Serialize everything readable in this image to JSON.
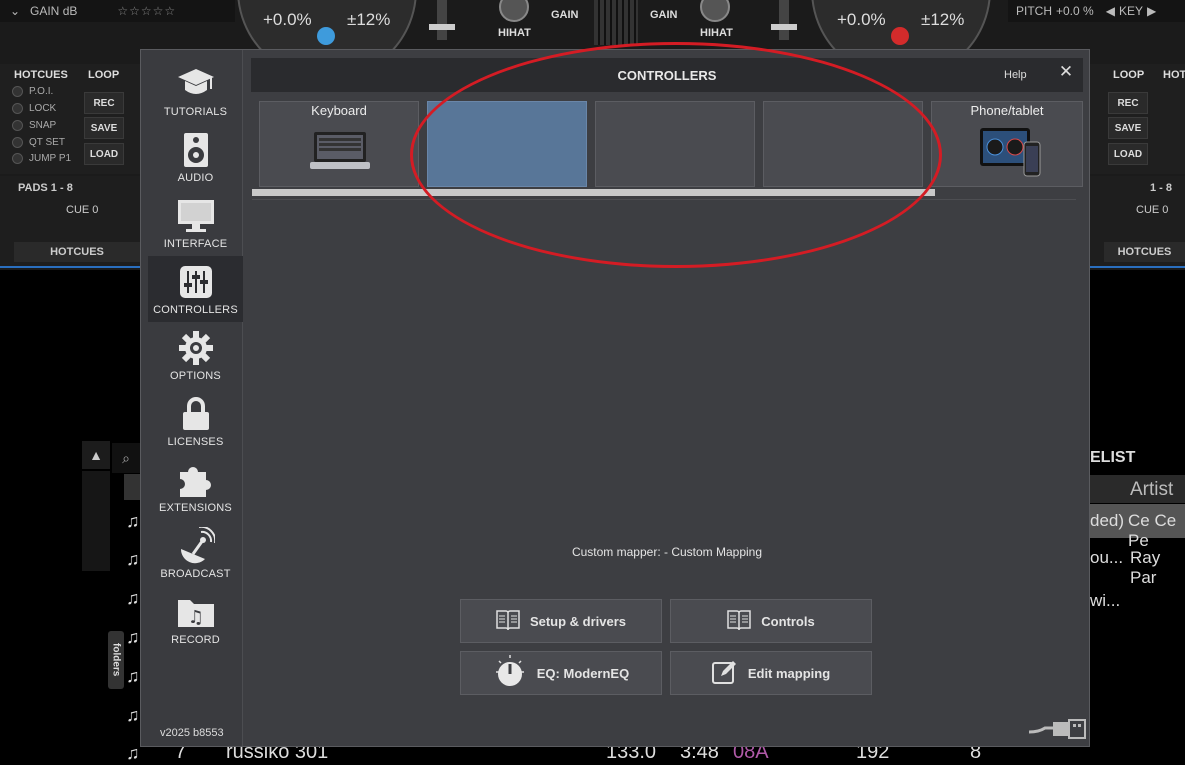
{
  "background": {
    "gain_label": "GAIN",
    "gain_unit": "dB",
    "rating_stars": "☆☆☆☆☆",
    "left_deck": {
      "pitch_pct": "+0.0%",
      "range": "±12%",
      "dot_color": "#3e9bdc"
    },
    "right_deck": {
      "pitch_pct": "+0.0%",
      "range": "±12%",
      "dot_color": "#d32b2b"
    },
    "mixer": {
      "gain_left": "GAIN",
      "gain_right": "GAIN",
      "hihat_left": "HIHAT",
      "hihat_right": "HIHAT"
    },
    "pitch_label": "PITCH",
    "pitch_value": "+0.0 %",
    "key_label": "KEY",
    "left_panel": {
      "hotcues": "HOTCUES",
      "loop": "LOOP",
      "items": [
        "P.O.I.",
        "LOCK",
        "SNAP",
        "QT SET",
        "JUMP P1"
      ],
      "buttons": [
        "REC",
        "SAVE",
        "LOAD"
      ],
      "pads_title": "PADS 1 - 8",
      "cue": "CUE 0",
      "hotcues_bar": "HOTCUES"
    },
    "right_panel": {
      "loop": "LOOP",
      "hotcues_short": "HOT",
      "buttons": [
        "REC",
        "SAVE",
        "LOAD"
      ],
      "pads_title": "1 - 8",
      "cue": "CUE 0",
      "hotcues_bar": "HOTCUES"
    },
    "browser": {
      "folders_tab": "folders",
      "playlist_header": "ELIST",
      "artist_header": "Artist",
      "rows": [
        {
          "left": "ded)",
          "right": "Ce Ce Pe"
        },
        {
          "left": "ou...",
          "right": "Ray Par"
        },
        {
          "left": "wi...",
          "right": ""
        }
      ],
      "track": {
        "num": "7",
        "title": "russiko 301",
        "bpm": "133.0",
        "length": "3:48",
        "key": "08A",
        "bitrate": "192",
        "plays": "8"
      }
    }
  },
  "dialog": {
    "title": "CONTROLLERS",
    "help_label": "Help",
    "version": "v2025 b8553",
    "nav": [
      {
        "id": "tutorials",
        "label": "TUTORIALS",
        "icon": "mortarboard-icon",
        "active": false
      },
      {
        "id": "audio",
        "label": "AUDIO",
        "icon": "speaker-icon",
        "active": false
      },
      {
        "id": "interface",
        "label": "INTERFACE",
        "icon": "monitor-icon",
        "active": false
      },
      {
        "id": "controllers",
        "label": "CONTROLLERS",
        "icon": "sliders-icon",
        "active": true
      },
      {
        "id": "options",
        "label": "OPTIONS",
        "icon": "gear-icon",
        "active": false
      },
      {
        "id": "licenses",
        "label": "LICENSES",
        "icon": "lock-icon",
        "active": false
      },
      {
        "id": "extensions",
        "label": "EXTENSIONS",
        "icon": "puzzle-icon",
        "active": false
      },
      {
        "id": "broadcast",
        "label": "BROADCAST",
        "icon": "satellite-dish-icon",
        "active": false
      },
      {
        "id": "record",
        "label": "RECORD",
        "icon": "music-folder-icon",
        "active": false
      }
    ],
    "controllers": [
      {
        "label": "Keyboard",
        "icon": "laptop-icon",
        "selected": false
      },
      {
        "label": "",
        "icon": "",
        "selected": true
      },
      {
        "label": "",
        "icon": "",
        "selected": false
      },
      {
        "label": "",
        "icon": "",
        "selected": false
      },
      {
        "label": "Phone/tablet",
        "icon": "tablet-phone-icon",
        "selected": false
      }
    ],
    "mapper_text": "Custom mapper: - Custom Mapping",
    "buttons": {
      "setup": "Setup & drivers",
      "controls": "Controls",
      "eq": "EQ: ModernEQ",
      "edit": "Edit mapping"
    },
    "colors": {
      "selected_tile": "#587698",
      "annotation": "#d41c24"
    }
  }
}
